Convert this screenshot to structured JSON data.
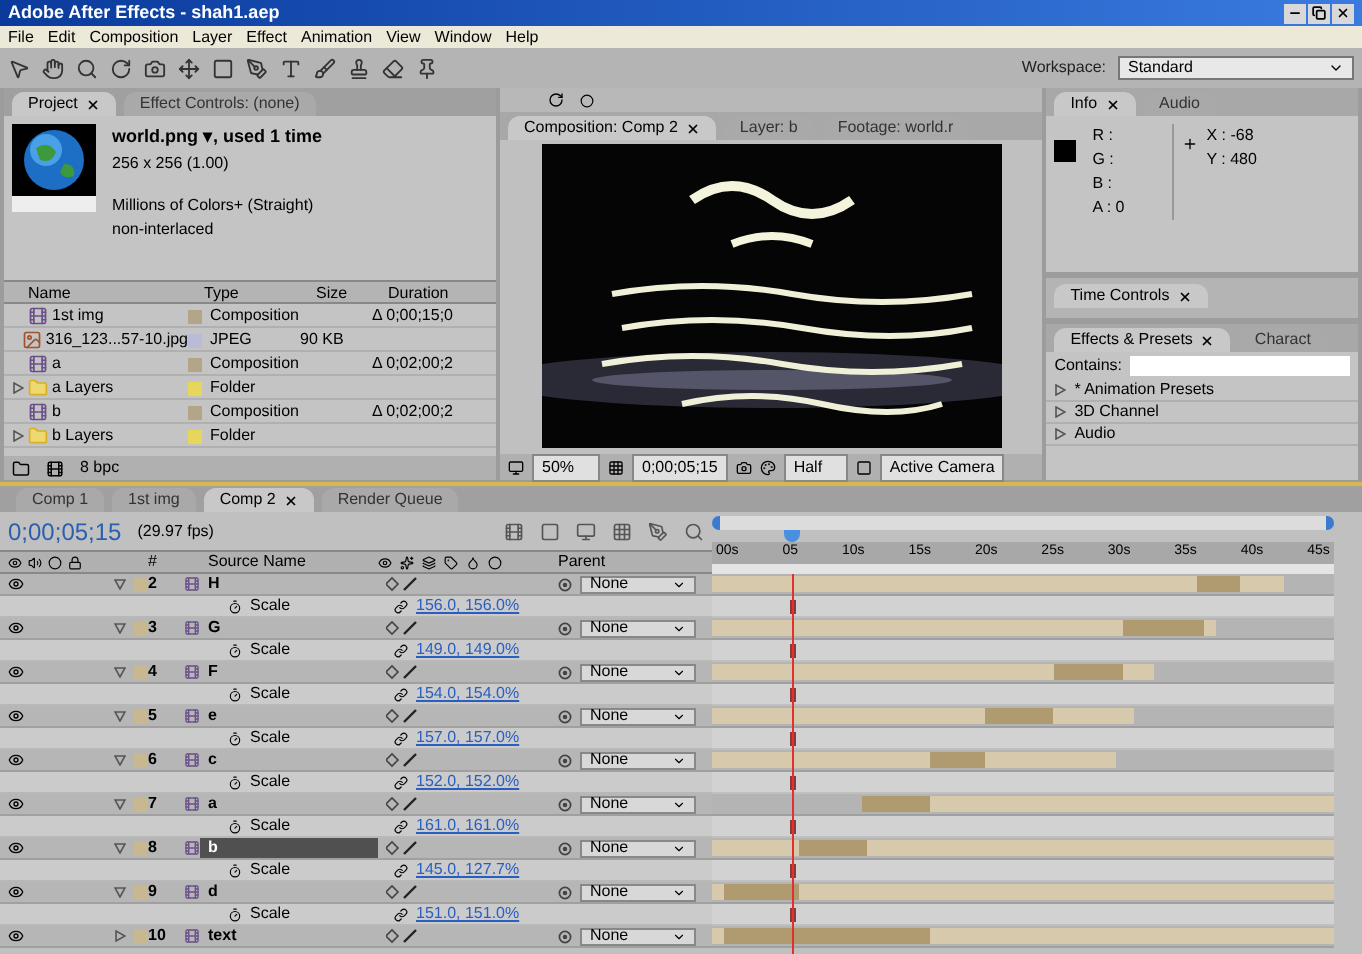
{
  "window": {
    "title": "Adobe After Effects - shah1.aep"
  },
  "menu": [
    "File",
    "Edit",
    "Composition",
    "Layer",
    "Effect",
    "Animation",
    "View",
    "Window",
    "Help"
  ],
  "workspace": {
    "label": "Workspace:",
    "value": "Standard"
  },
  "project_panel": {
    "tabs": [
      {
        "label": "Project",
        "selected": true
      },
      {
        "label": "Effect Controls: (none)",
        "selected": false
      }
    ],
    "preview": {
      "name": "world.png ▾, used 1 time",
      "dimensions": "256 x 256 (1.00)",
      "lines": [
        "Millions of Colors+ (Straight)",
        "non-interlaced"
      ]
    },
    "columns": [
      "Name",
      "Type",
      "Size",
      "Duration"
    ],
    "items": [
      {
        "kind": "composition",
        "name": "1st img",
        "color": "#b3a58a",
        "type": "Composition",
        "duration": "Δ 0;00;15;0"
      },
      {
        "kind": "footage",
        "name": "316_123...57-10.jpg",
        "color": "#b9bbd8",
        "type": "JPEG",
        "size": "90 KB"
      },
      {
        "kind": "composition",
        "name": "a",
        "color": "#b3a58a",
        "type": "Composition",
        "duration": "Δ 0;02;00;2"
      },
      {
        "kind": "folder",
        "name": "a Layers",
        "color": "#e6d65c",
        "type": "Folder",
        "expanded": false
      },
      {
        "kind": "composition",
        "name": "b",
        "color": "#b3a58a",
        "type": "Composition",
        "duration": "Δ 0;02;00;2"
      },
      {
        "kind": "folder",
        "name": "b Layers",
        "color": "#e6d65c",
        "type": "Folder",
        "expanded": false
      }
    ],
    "bit_depth": "8 bpc"
  },
  "composition_viewer": {
    "tabs": [
      {
        "label": "Composition: Comp 2",
        "selected": true
      },
      {
        "label": "Layer: b",
        "selected": false
      },
      {
        "label": "Footage: world.r",
        "selected": false
      }
    ],
    "zoom": "50%",
    "timecode": "0;00;05;15",
    "resolution": "Half",
    "camera": "Active Camera"
  },
  "info_panel": {
    "tabs": [
      {
        "label": "Info",
        "selected": true
      },
      {
        "label": "Audio",
        "selected": false
      }
    ],
    "channels": [
      "R :",
      "G :",
      "B :",
      "A : 0"
    ],
    "coords": [
      "X : -68",
      "Y : 480"
    ]
  },
  "time_controls": {
    "tabs": [
      {
        "label": "Time Controls",
        "selected": true
      }
    ]
  },
  "effects_panel": {
    "tabs": [
      {
        "label": "Effects & Presets",
        "selected": true
      },
      {
        "label": "Charact",
        "selected": false
      }
    ],
    "search_label": "Contains:",
    "items": [
      {
        "label": "* Animation Presets",
        "expanded": false
      },
      {
        "label": "3D Channel",
        "expanded": false
      },
      {
        "label": "Audio",
        "expanded": false
      }
    ]
  },
  "timeline": {
    "tabs": [
      {
        "label": "Comp 1",
        "selected": false
      },
      {
        "label": "1st img",
        "selected": false
      },
      {
        "label": "Comp 2",
        "selected": true
      },
      {
        "label": "Render Queue",
        "selected": false
      }
    ],
    "timecode": "0;00;05;15",
    "fps": "(29.97 fps)",
    "columns": {
      "number": "#",
      "source": "Source Name",
      "parent": "Parent"
    },
    "ruler": [
      "00s",
      "05",
      "10s",
      "15s",
      "20s",
      "25s",
      "30s",
      "35s",
      "40s",
      "45s"
    ],
    "playhead": {
      "level": 0.13
    },
    "layers": [
      {
        "number": "2",
        "name": "H",
        "selected": false,
        "expanded": true,
        "visible": true,
        "parent": "None",
        "property": "Scale",
        "scale": "156.0, 156.0%"
      },
      {
        "number": "3",
        "name": "G",
        "selected": false,
        "expanded": true,
        "visible": true,
        "parent": "None",
        "property": "Scale",
        "scale": "149.0, 149.0%"
      },
      {
        "number": "4",
        "name": "F",
        "selected": false,
        "expanded": true,
        "visible": true,
        "parent": "None",
        "property": "Scale",
        "scale": "154.0, 154.0%"
      },
      {
        "number": "5",
        "name": "e",
        "selected": false,
        "expanded": true,
        "visible": true,
        "parent": "None",
        "property": "Scale",
        "scale": "157.0, 157.0%"
      },
      {
        "number": "6",
        "name": "c",
        "selected": false,
        "expanded": true,
        "visible": true,
        "parent": "None",
        "property": "Scale",
        "scale": "152.0, 152.0%"
      },
      {
        "number": "7",
        "name": "a",
        "selected": false,
        "expanded": true,
        "visible": true,
        "parent": "None",
        "property": "Scale",
        "scale": "161.0, 161.0%"
      },
      {
        "number": "8",
        "name": "b",
        "selected": true,
        "expanded": true,
        "visible": true,
        "parent": "None",
        "property": "Scale",
        "scale": "145.0, 127.7%"
      },
      {
        "number": "9",
        "name": "d",
        "selected": false,
        "expanded": true,
        "visible": true,
        "parent": "None",
        "property": "Scale",
        "scale": "151.0, 151.0%"
      },
      {
        "number": "10",
        "name": "text",
        "selected": false,
        "expanded": false,
        "visible": true,
        "parent": "None"
      }
    ]
  }
}
